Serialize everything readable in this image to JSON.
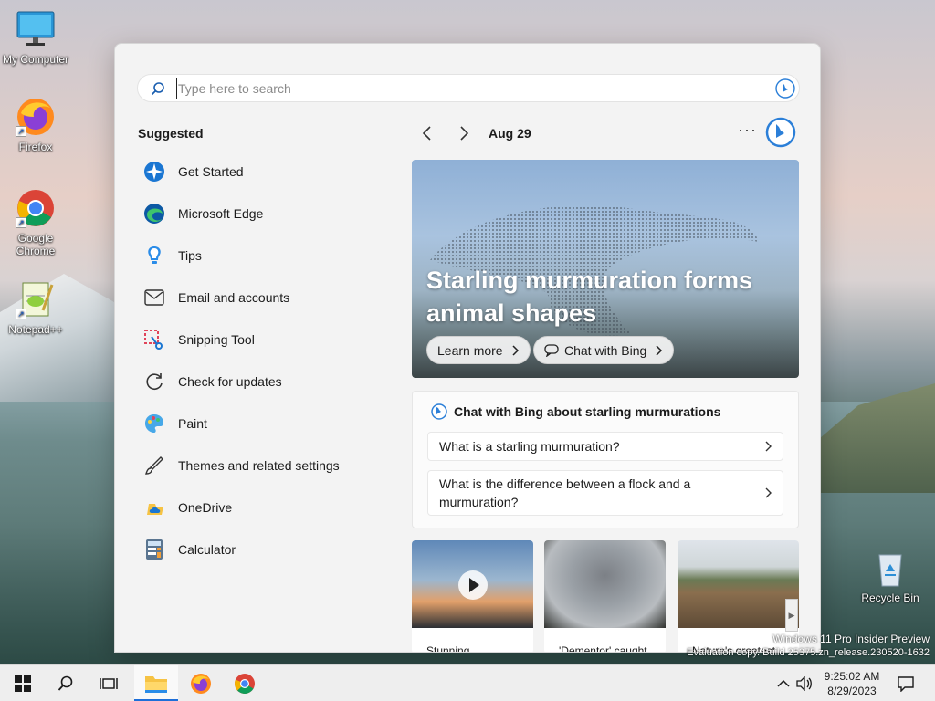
{
  "desktop": {
    "icons": [
      {
        "label": "My Computer"
      },
      {
        "label": "Firefox"
      },
      {
        "label": "Google Chrome"
      },
      {
        "label": "Notepad++"
      },
      {
        "label": "Recycle Bin"
      }
    ],
    "watermark": {
      "line1": "Windows 11 Pro Insider Preview",
      "line2": "Evaluation copy. Build 25375.zn_release.230520-1632"
    }
  },
  "start_menu": {
    "search": {
      "placeholder": "Type here to search",
      "value": ""
    },
    "suggested_title": "Suggested",
    "suggested": [
      {
        "label": "Get Started",
        "icon": "get-started-icon"
      },
      {
        "label": "Microsoft Edge",
        "icon": "edge-icon"
      },
      {
        "label": "Tips",
        "icon": "tips-icon"
      },
      {
        "label": "Email and accounts",
        "icon": "mail-icon"
      },
      {
        "label": "Snipping Tool",
        "icon": "snipping-tool-icon"
      },
      {
        "label": "Check for updates",
        "icon": "refresh-icon"
      },
      {
        "label": "Paint",
        "icon": "paint-icon"
      },
      {
        "label": "Themes and related settings",
        "icon": "brush-icon"
      },
      {
        "label": "OneDrive",
        "icon": "onedrive-icon"
      },
      {
        "label": "Calculator",
        "icon": "calculator-icon"
      }
    ],
    "nav": {
      "date": "Aug 29",
      "more": "···"
    },
    "hero": {
      "title": "Starling murmuration forms animal shapes",
      "learn_more": "Learn more",
      "chat": "Chat with Bing"
    },
    "chat_card": {
      "title": "Chat with Bing about starling murmurations",
      "questions": [
        "What is a starling murmuration?",
        "What is the difference between a flock and a murmuration?"
      ]
    },
    "thumbnails": [
      {
        "caption": "Stunning"
      },
      {
        "caption": "'Dementor' caught"
      },
      {
        "caption": "Nature's greatest"
      }
    ]
  },
  "taskbar": {
    "clock": {
      "time": "9:25:02 AM",
      "date": "8/29/2023"
    }
  },
  "colors": {
    "accent": "#1e6fd9",
    "start_bg": "#f3f3f3",
    "taskbar_bg": "#eeeeee"
  }
}
